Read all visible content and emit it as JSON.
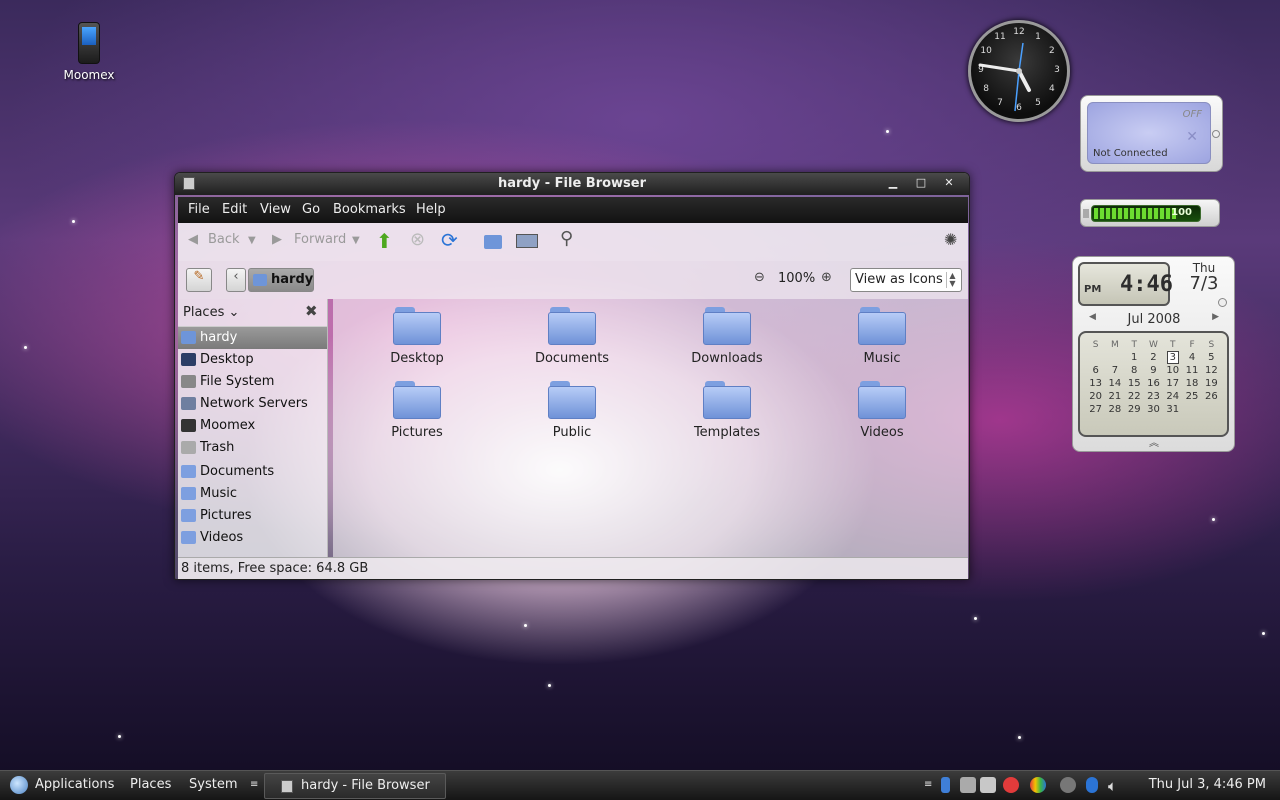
{
  "desktop": {
    "icons": [
      {
        "label": "Moomex"
      }
    ],
    "colors": {
      "accent": "#5f7fc4",
      "titlebar": "#2a2a2a"
    }
  },
  "clock_widget": {
    "numerals": [
      "12",
      "1",
      "2",
      "3",
      "4",
      "5",
      "6",
      "7",
      "8",
      "9",
      "10",
      "11"
    ],
    "time": "4:46"
  },
  "wifi_widget": {
    "state_label": "OFF",
    "status": "Not Connected",
    "icon": "wifi-signal-icon"
  },
  "battery_widget": {
    "value": "100",
    "level_percent": 100
  },
  "calendar_widget": {
    "ampm": "PM",
    "time": "4:46",
    "weekday": "Thu",
    "date": "7/3",
    "month_label": "Jul 2008",
    "weekday_headers": [
      "S",
      "M",
      "T",
      "W",
      "T",
      "F",
      "S"
    ],
    "weeks": [
      [
        "",
        "",
        "1",
        "2",
        "3",
        "4",
        "5"
      ],
      [
        "6",
        "7",
        "8",
        "9",
        "10",
        "11",
        "12"
      ],
      [
        "13",
        "14",
        "15",
        "16",
        "17",
        "18",
        "19"
      ],
      [
        "20",
        "21",
        "22",
        "23",
        "24",
        "25",
        "26"
      ],
      [
        "27",
        "28",
        "29",
        "30",
        "31",
        "",
        ""
      ]
    ],
    "today": "3"
  },
  "window": {
    "title": "hardy - File Browser",
    "menu": [
      "File",
      "Edit",
      "View",
      "Go",
      "Bookmarks",
      "Help"
    ],
    "toolbar": {
      "back": "Back",
      "forward": "Forward"
    },
    "location": {
      "path": "hardy",
      "zoom": "100%",
      "view_mode": "View as Icons"
    },
    "sidebar": {
      "header": "Places",
      "items": [
        {
          "label": "hardy",
          "icon": "home-folder-icon",
          "selected": true
        },
        {
          "label": "Desktop",
          "icon": "desktop-icon"
        },
        {
          "label": "File System",
          "icon": "filesystem-icon"
        },
        {
          "label": "Network Servers",
          "icon": "network-icon"
        },
        {
          "label": "Moomex",
          "icon": "phone-device-icon"
        },
        {
          "label": "Trash",
          "icon": "trash-icon"
        },
        {
          "label": "Documents",
          "icon": "folder-icon"
        },
        {
          "label": "Music",
          "icon": "folder-icon"
        },
        {
          "label": "Pictures",
          "icon": "folder-icon"
        },
        {
          "label": "Videos",
          "icon": "folder-icon"
        }
      ]
    },
    "files": [
      "Desktop",
      "Documents",
      "Downloads",
      "Music",
      "Pictures",
      "Public",
      "Templates",
      "Videos"
    ],
    "status": "8 items, Free space: 64.8 GB"
  },
  "taskbar": {
    "menus": [
      "Applications",
      "Places",
      "System"
    ],
    "task_title": "hardy - File Browser",
    "clock": "Thu Jul  3,  4:46 PM"
  }
}
